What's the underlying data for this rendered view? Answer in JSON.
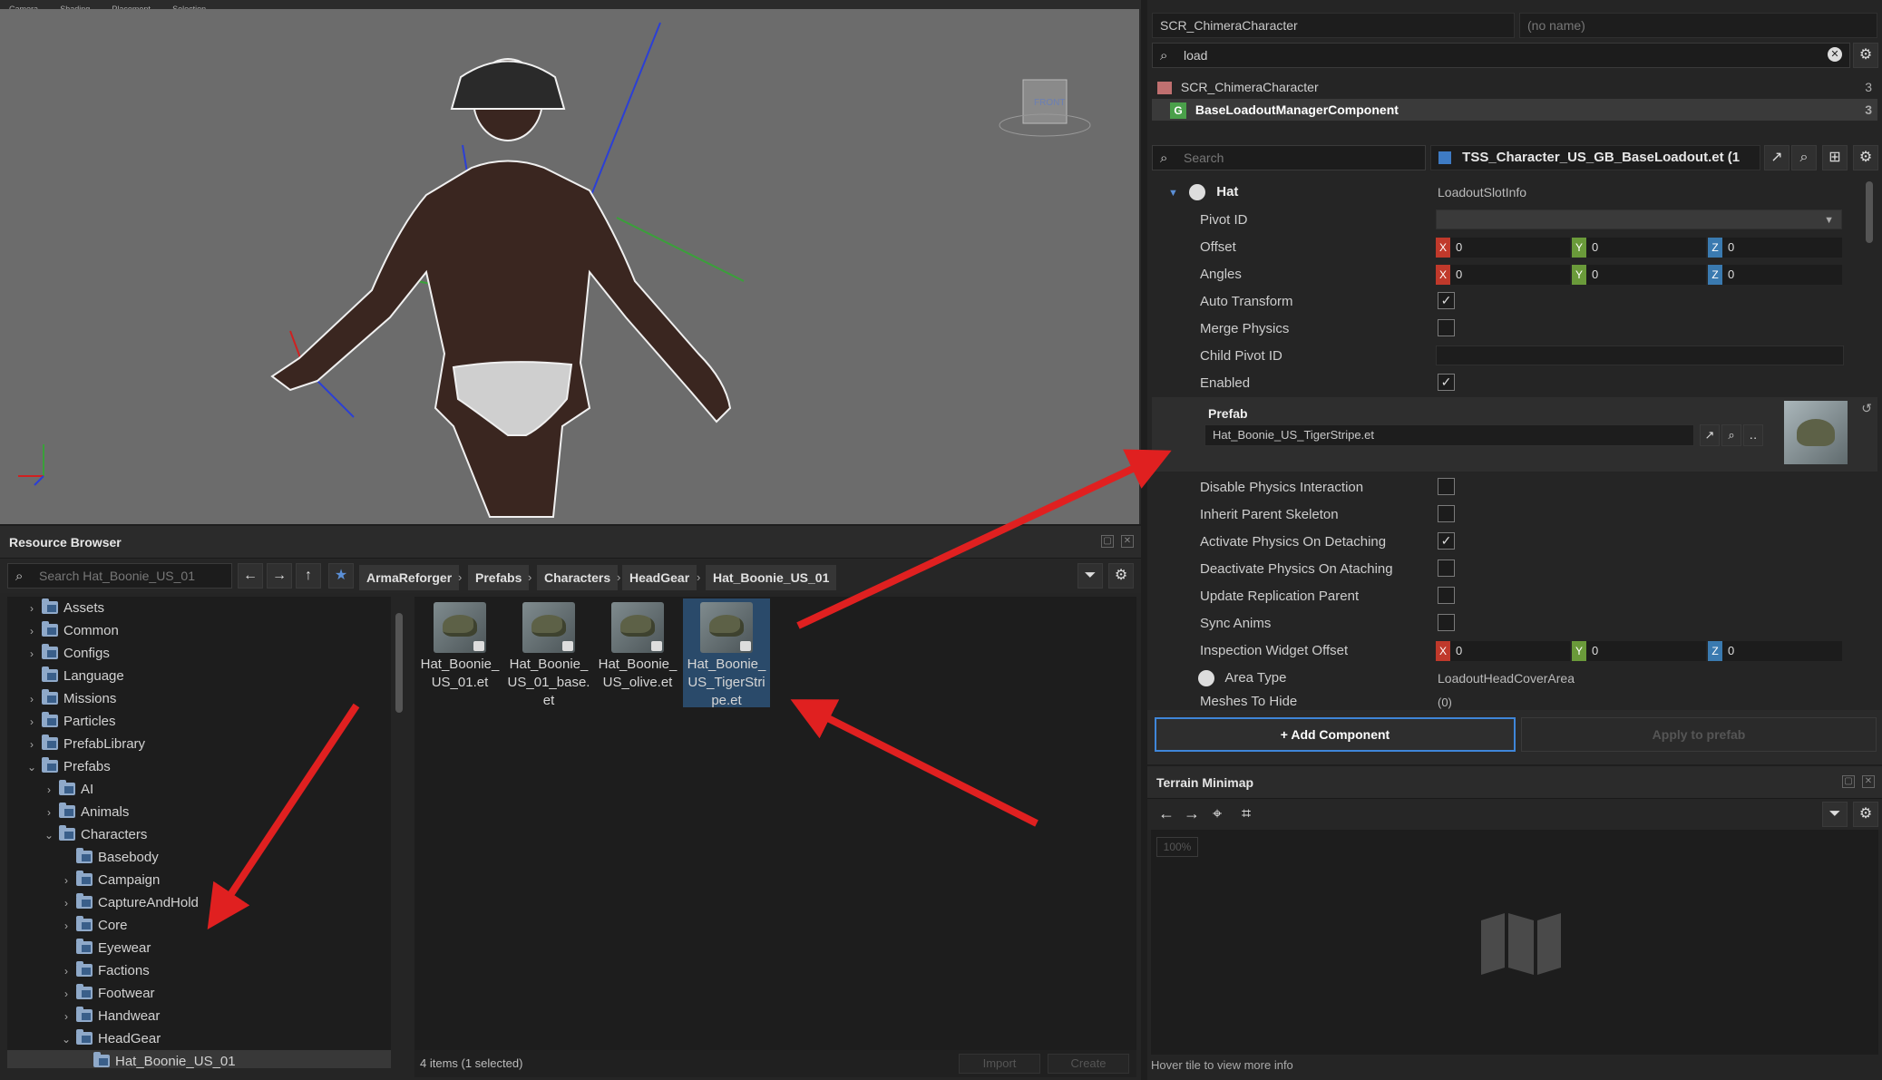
{
  "top_menu": [
    "Camera",
    "Shading",
    "Placement",
    "Selection"
  ],
  "viewport": {
    "gizmo_label": "FRONT"
  },
  "resource_browser": {
    "title": "Resource Browser",
    "search_placeholder": "Search Hat_Boonie_US_01",
    "breadcrumbs": [
      "ArmaReforger",
      "Prefabs",
      "Characters",
      "HeadGear",
      "Hat_Boonie_US_01"
    ],
    "tree": [
      {
        "label": "Assets",
        "depth": 0,
        "expander": "›"
      },
      {
        "label": "Common",
        "depth": 0,
        "expander": "›"
      },
      {
        "label": "Configs",
        "depth": 0,
        "expander": "›"
      },
      {
        "label": "Language",
        "depth": 0,
        "expander": ""
      },
      {
        "label": "Missions",
        "depth": 0,
        "expander": "›"
      },
      {
        "label": "Particles",
        "depth": 0,
        "expander": "›"
      },
      {
        "label": "PrefabLibrary",
        "depth": 0,
        "expander": "›"
      },
      {
        "label": "Prefabs",
        "depth": 0,
        "expander": "⌄"
      },
      {
        "label": "AI",
        "depth": 1,
        "expander": "›"
      },
      {
        "label": "Animals",
        "depth": 1,
        "expander": "›"
      },
      {
        "label": "Characters",
        "depth": 1,
        "expander": "⌄"
      },
      {
        "label": "Basebody",
        "depth": 2,
        "expander": ""
      },
      {
        "label": "Campaign",
        "depth": 2,
        "expander": "›"
      },
      {
        "label": "CaptureAndHold",
        "depth": 2,
        "expander": "›"
      },
      {
        "label": "Core",
        "depth": 2,
        "expander": "›"
      },
      {
        "label": "Eyewear",
        "depth": 2,
        "expander": ""
      },
      {
        "label": "Factions",
        "depth": 2,
        "expander": "›"
      },
      {
        "label": "Footwear",
        "depth": 2,
        "expander": "›"
      },
      {
        "label": "Handwear",
        "depth": 2,
        "expander": "›"
      },
      {
        "label": "HeadGear",
        "depth": 2,
        "expander": "⌄"
      },
      {
        "label": "Hat_Boonie_US_01",
        "depth": 3,
        "expander": "",
        "selected": true
      }
    ],
    "files": [
      {
        "lines": [
          "Hat_Boonie_",
          "US_01.et"
        ],
        "selected": false
      },
      {
        "lines": [
          "Hat_Boonie_",
          "US_01_base.",
          "et"
        ],
        "selected": false
      },
      {
        "lines": [
          "Hat_Boonie_",
          "US_olive.et"
        ],
        "selected": false
      },
      {
        "lines": [
          "Hat_Boonie_",
          "US_TigerStri",
          "pe.et"
        ],
        "selected": true
      }
    ],
    "status": "4 items (1 selected)",
    "import_label": "Import",
    "create_label": "Create"
  },
  "inspector": {
    "entity_class": "SCR_ChimeraCharacter",
    "entity_name_placeholder": "(no name)",
    "component_filter": "load",
    "entities": [
      {
        "label": "SCR_ChimeraCharacter",
        "count": "3"
      },
      {
        "label": "BaseLoadoutManagerComponent",
        "count": "3"
      }
    ],
    "search_placeholder": "Search",
    "prefab_file": "TSS_Character_US_GB_BaseLoadout.et (1",
    "section": "Hat",
    "section_type": "LoadoutSlotInfo",
    "props": {
      "pivot_id": "Pivot ID",
      "offset": "Offset",
      "angles": "Angles",
      "auto_transform": "Auto Transform",
      "merge_physics": "Merge Physics",
      "child_pivot_id": "Child Pivot ID",
      "enabled": "Enabled",
      "prefab": "Prefab",
      "prefab_value": "Hat_Boonie_US_TigerStripe.et",
      "disable_physics_interaction": "Disable Physics Interaction",
      "inherit_parent_skeleton": "Inherit Parent Skeleton",
      "activate_physics_on_detaching": "Activate Physics On Detaching",
      "deactivate_physics_on_ataching": "Deactivate Physics On Ataching",
      "update_replication_parent": "Update Replication Parent",
      "sync_anims": "Sync Anims",
      "inspection_widget_offset": "Inspection Widget Offset",
      "area_type": "Area Type",
      "area_type_value": "LoadoutHeadCoverArea",
      "meshes_to_hide": "Meshes To Hide",
      "meshes_to_hide_value": "(0)"
    },
    "vector_zero": "0",
    "axis_x": "X",
    "axis_y": "Y",
    "axis_z": "Z",
    "add_component": "+ Add Component",
    "apply_to_prefab": "Apply to prefab"
  },
  "terrain_minimap": {
    "title": "Terrain Minimap",
    "zoom": "100%",
    "hint": "Hover tile to view more info"
  },
  "colors": {
    "annotation_arrow": "#e02020",
    "axis_x": "#c0392b",
    "axis_y": "#6a9a3a",
    "axis_z": "#3a7ab0",
    "selection": "#2a4a6a"
  }
}
